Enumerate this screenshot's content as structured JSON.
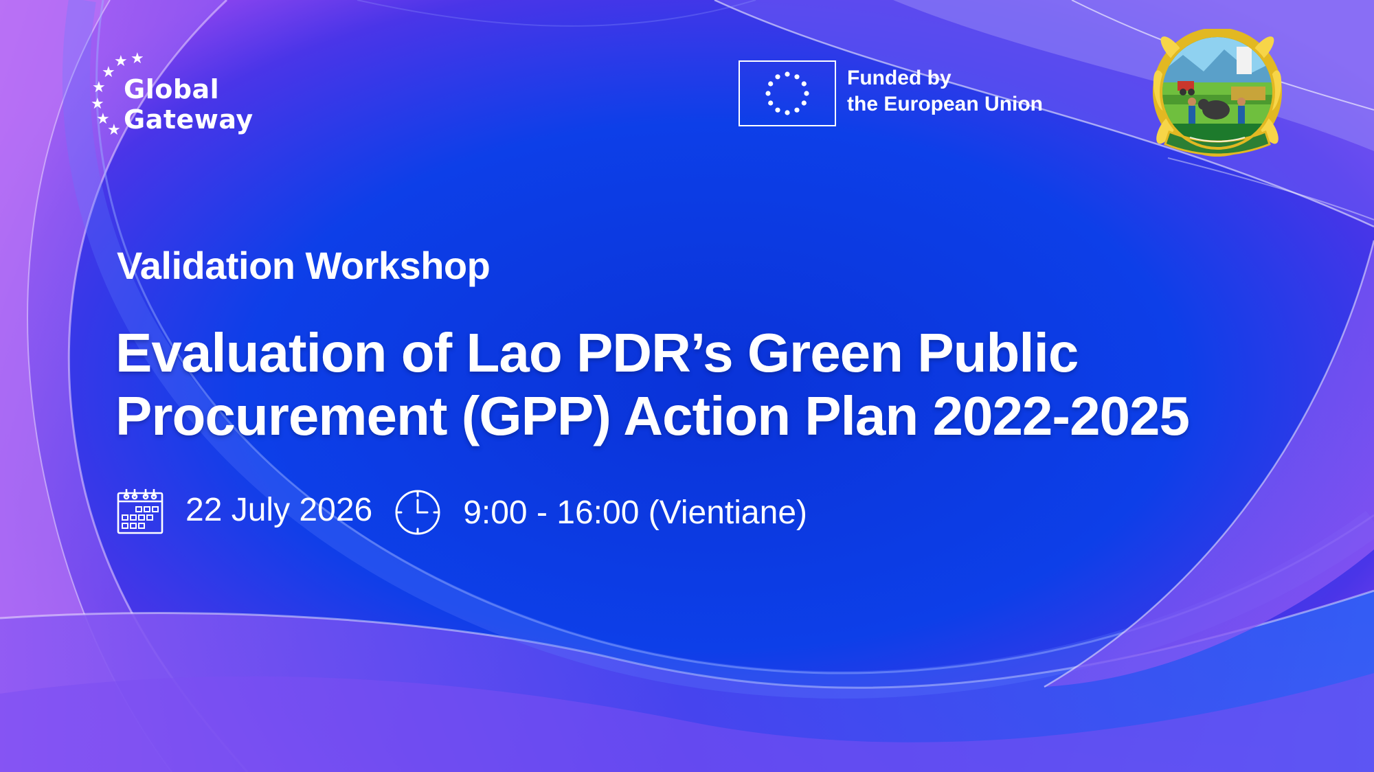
{
  "logos": {
    "global_gateway": {
      "line1": "Global",
      "line2": "Gateway"
    },
    "eu": {
      "line1": "Funded by",
      "line2": "the European Union"
    },
    "ministry_seal": {
      "icon": "ministry-seal-icon"
    }
  },
  "event": {
    "subtitle": "Validation Workshop",
    "title_line1": "Evaluation of Lao PDR’s Green Public",
    "title_line2": "Procurement (GPP) Action Plan 2022-2025",
    "date": "22 July 2026",
    "time": "9:00 - 16:00 (Vientiane)"
  },
  "icons": {
    "date": "calendar-icon",
    "time": "clock-icon"
  },
  "colors": {
    "background_center": "#0a3ce6",
    "background_edge": "#7a3cf0",
    "text": "#ffffff"
  }
}
